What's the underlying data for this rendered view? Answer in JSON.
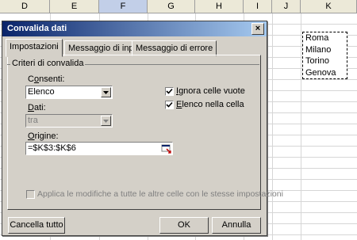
{
  "sheet": {
    "columns": [
      "D",
      "E",
      "F",
      "G",
      "H",
      "I",
      "J",
      "K"
    ],
    "selected_column": "F",
    "list_values": [
      "Roma",
      "Milano",
      "Torino",
      "Genova"
    ]
  },
  "dialog": {
    "title": "Convalida dati",
    "close_symbol": "×",
    "tabs": [
      "Impostazioni",
      "Messaggio di input",
      "Messaggio di errore"
    ],
    "group_label": "Criteri di convalida",
    "allow": {
      "label": "Consenti:",
      "value": "Elenco"
    },
    "data": {
      "label": "Dati:",
      "value": "tra"
    },
    "source": {
      "label": "Origine:",
      "value": "=$K$3:$K$6"
    },
    "ignore_blank": {
      "label": "Ignora celle vuote",
      "checked": true
    },
    "in_cell_dropdown": {
      "label": "Elenco nella cella",
      "checked": true
    },
    "apply_all": {
      "label": "Applica le modifiche a tutte le altre celle con le stesse impostazioni",
      "checked": false
    },
    "buttons": {
      "clear_all": "Cancella tutto",
      "ok": "OK",
      "cancel": "Annulla"
    }
  }
}
